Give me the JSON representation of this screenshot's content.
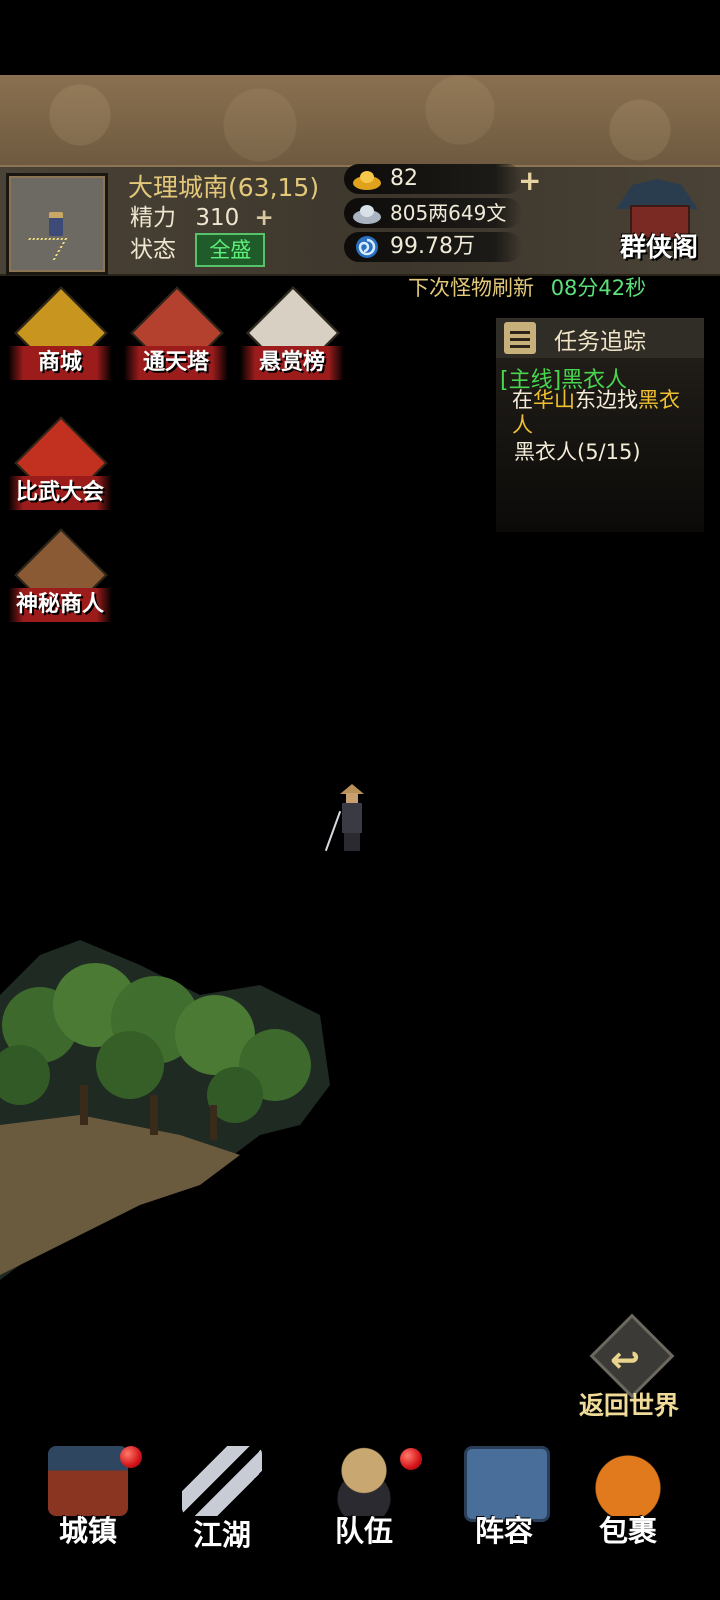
{
  "status": {
    "location": "大理城南(63,15)",
    "stamina_label": "精力",
    "stamina_value": "310",
    "state_label": "状态",
    "state_value": "全盛"
  },
  "currency": {
    "gold": "82",
    "silver": "805两649文",
    "power": "99.78万"
  },
  "guild": {
    "label": "群侠阁"
  },
  "refresh": {
    "label": "下次怪物刷新",
    "time": "08分42秒"
  },
  "activities": [
    {
      "label": "商城",
      "icon": "gold-ingot-icon"
    },
    {
      "label": "通天塔",
      "icon": "tower-icon"
    },
    {
      "label": "悬赏榜",
      "icon": "bounty-poster-icon"
    },
    {
      "label": "比武大会",
      "icon": "duel-banner-icon"
    },
    {
      "label": "神秘商人",
      "icon": "merchant-portrait-icon"
    }
  ],
  "quest": {
    "title": "任务追踪",
    "main": "[主线]黑衣人",
    "desc_prefix": "在",
    "desc_place": "华山",
    "desc_middle": "东边找",
    "desc_target": "黑衣人",
    "progress": "黑衣人(5/15)"
  },
  "return_world": "返回世界",
  "nav": [
    {
      "label": "城镇",
      "badge": true
    },
    {
      "label": "江湖",
      "badge": false
    },
    {
      "label": "队伍",
      "badge": true
    },
    {
      "label": "阵容",
      "badge": false
    },
    {
      "label": "包裹",
      "badge": false
    }
  ]
}
